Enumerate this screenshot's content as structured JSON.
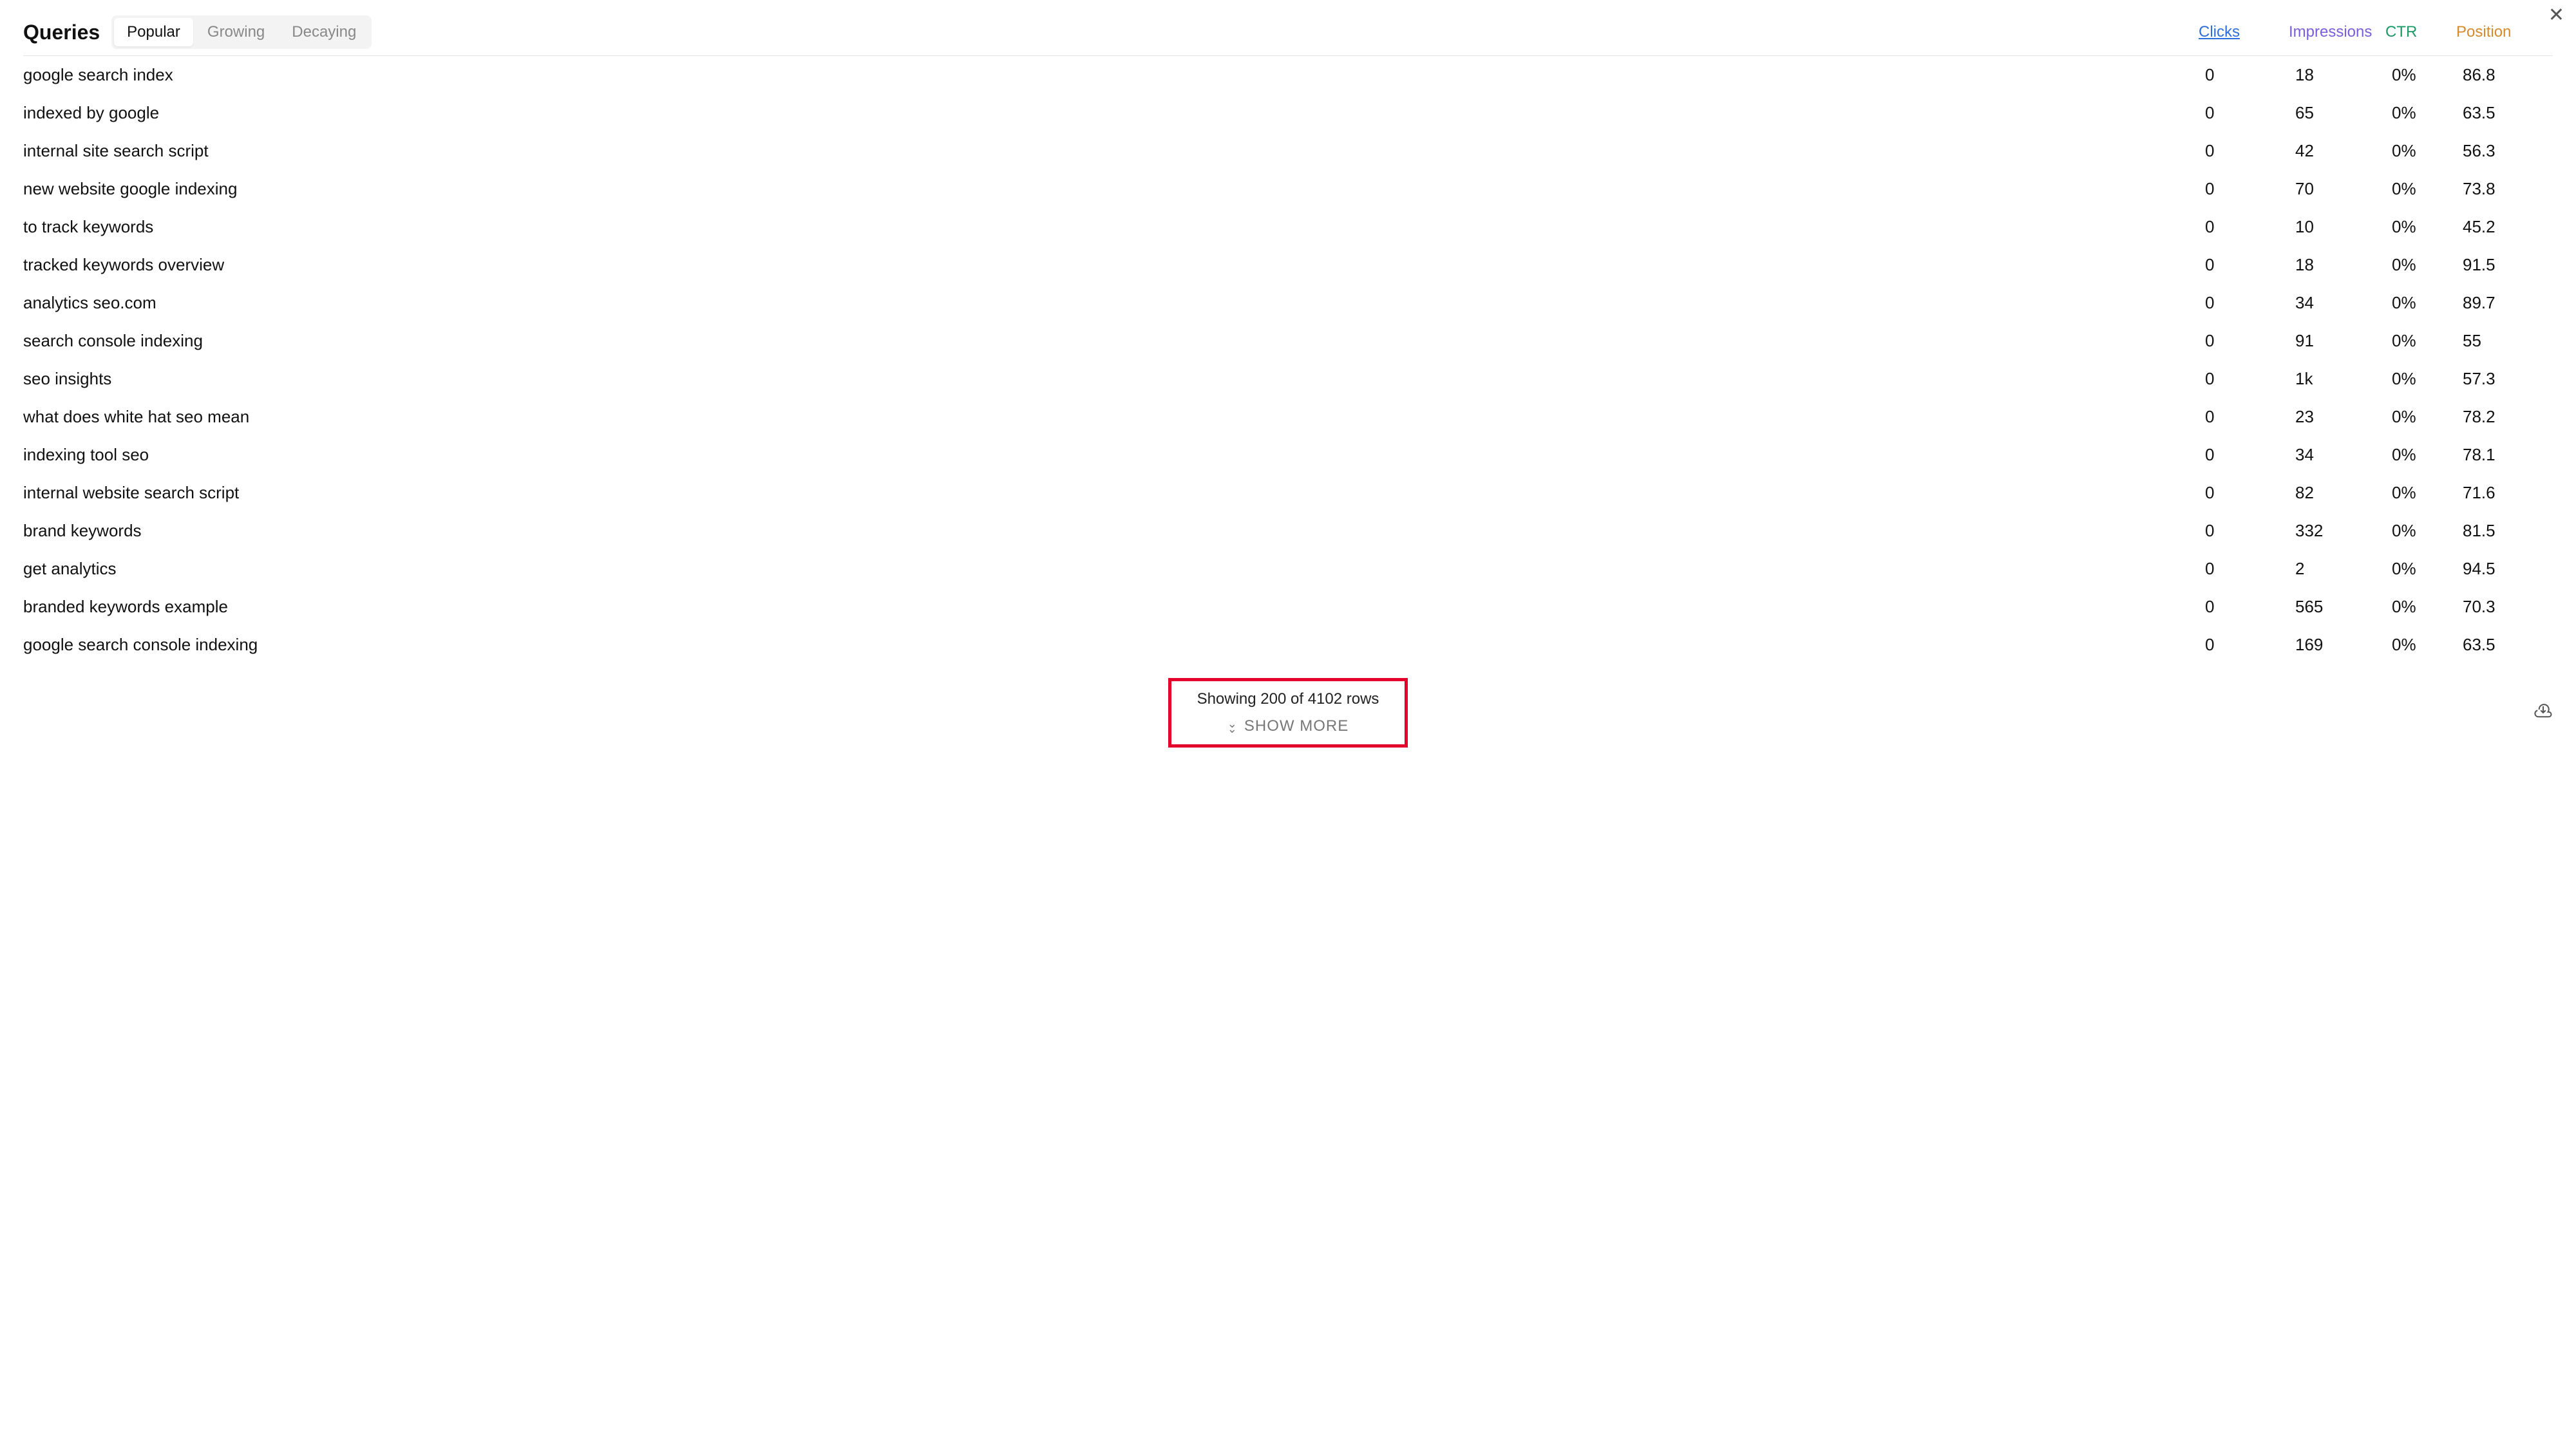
{
  "title": "Queries",
  "tabs": [
    "Popular",
    "Growing",
    "Decaying"
  ],
  "active_tab": 0,
  "columns": {
    "clicks": "Clicks",
    "impressions": "Impressions",
    "ctr": "CTR",
    "position": "Position"
  },
  "rows": [
    {
      "query": "google search index",
      "clicks": "0",
      "impressions": "18",
      "ctr": "0%",
      "position": "86.8"
    },
    {
      "query": "indexed by google",
      "clicks": "0",
      "impressions": "65",
      "ctr": "0%",
      "position": "63.5"
    },
    {
      "query": "internal site search script",
      "clicks": "0",
      "impressions": "42",
      "ctr": "0%",
      "position": "56.3"
    },
    {
      "query": "new website google indexing",
      "clicks": "0",
      "impressions": "70",
      "ctr": "0%",
      "position": "73.8"
    },
    {
      "query": "to track keywords",
      "clicks": "0",
      "impressions": "10",
      "ctr": "0%",
      "position": "45.2"
    },
    {
      "query": "tracked keywords overview",
      "clicks": "0",
      "impressions": "18",
      "ctr": "0%",
      "position": "91.5"
    },
    {
      "query": "analytics seo.com",
      "clicks": "0",
      "impressions": "34",
      "ctr": "0%",
      "position": "89.7"
    },
    {
      "query": "search console indexing",
      "clicks": "0",
      "impressions": "91",
      "ctr": "0%",
      "position": "55"
    },
    {
      "query": "seo insights",
      "clicks": "0",
      "impressions": "1k",
      "ctr": "0%",
      "position": "57.3"
    },
    {
      "query": "what does white hat seo mean",
      "clicks": "0",
      "impressions": "23",
      "ctr": "0%",
      "position": "78.2"
    },
    {
      "query": "indexing tool seo",
      "clicks": "0",
      "impressions": "34",
      "ctr": "0%",
      "position": "78.1"
    },
    {
      "query": "internal website search script",
      "clicks": "0",
      "impressions": "82",
      "ctr": "0%",
      "position": "71.6"
    },
    {
      "query": "brand keywords",
      "clicks": "0",
      "impressions": "332",
      "ctr": "0%",
      "position": "81.5"
    },
    {
      "query": "get analytics",
      "clicks": "0",
      "impressions": "2",
      "ctr": "0%",
      "position": "94.5"
    },
    {
      "query": "branded keywords example",
      "clicks": "0",
      "impressions": "565",
      "ctr": "0%",
      "position": "70.3"
    },
    {
      "query": "google search console indexing",
      "clicks": "0",
      "impressions": "169",
      "ctr": "0%",
      "position": "63.5"
    }
  ],
  "footer": {
    "status": "Showing 200 of 4102 rows",
    "show_more": "SHOW MORE"
  }
}
